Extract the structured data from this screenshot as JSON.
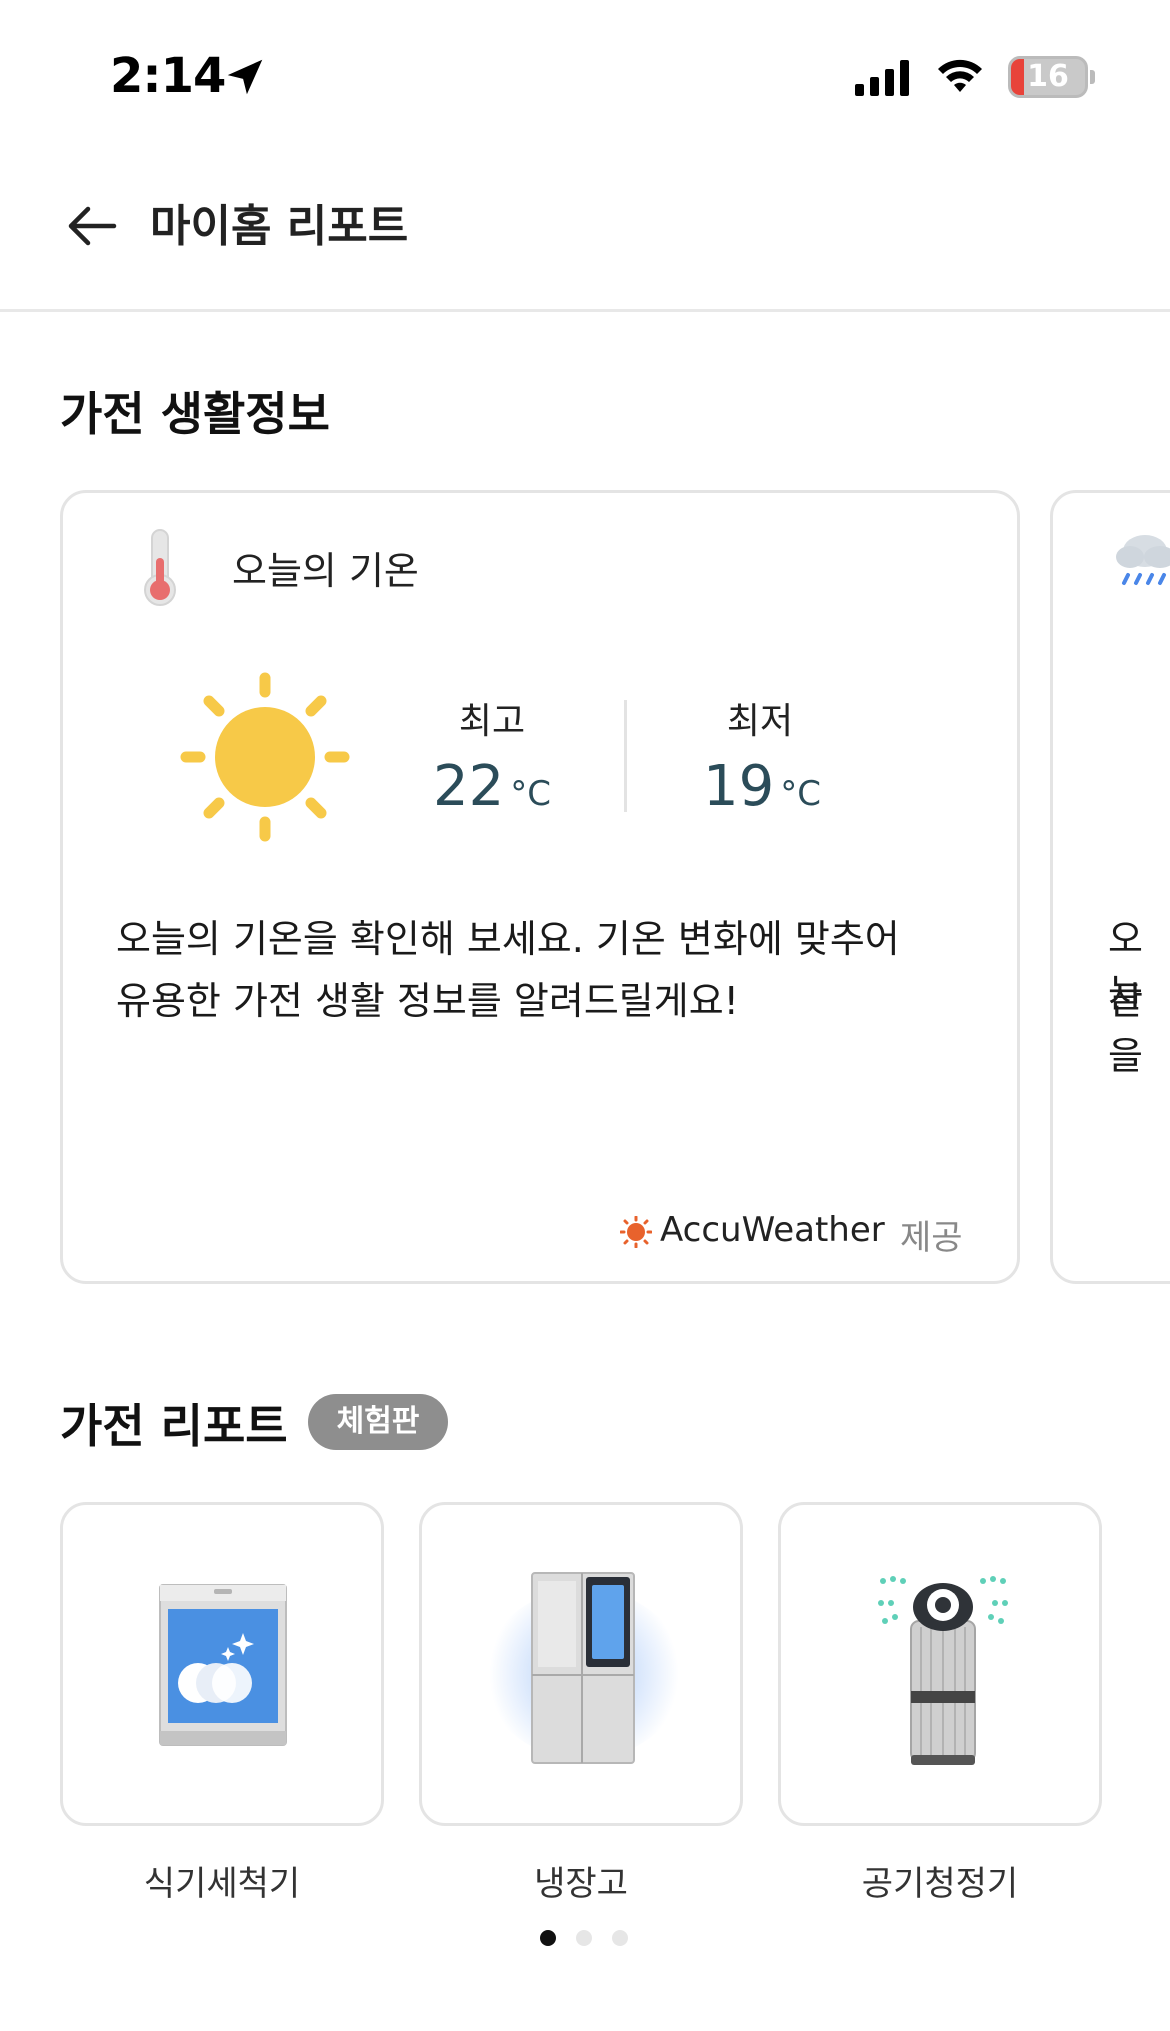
{
  "status_bar": {
    "time": "2:14",
    "battery": "16"
  },
  "header": {
    "title": "마이홈 리포트"
  },
  "appliance_life": {
    "section_title": "가전 생활정보",
    "weather_card": {
      "title": "오늘의 기온",
      "high_label": "최고",
      "high_value": "22",
      "low_label": "최저",
      "low_value": "19",
      "unit": "°C",
      "description_line1": "오늘의 기온을 확인해 보세요. 기온 변화에 맞추어",
      "description_line2": "유용한 가전 생활 정보를 알려드릴게요!",
      "provider": "AccuWeather",
      "provider_suffix": "제공"
    },
    "peek_card": {
      "line1": "오늘",
      "line2": "산을"
    }
  },
  "appliance_report": {
    "section_title": "가전 리포트",
    "badge": "체험판",
    "items": [
      {
        "label": "식기세척기",
        "icon": "dishwasher-icon"
      },
      {
        "label": "냉장고",
        "icon": "refrigerator-icon"
      },
      {
        "label": "공기청정기",
        "icon": "air-purifier-icon"
      }
    ],
    "pagination": {
      "current": 1,
      "total": 3
    }
  },
  "colors": {
    "temperature": "#2b4c59",
    "sun": "#f7c948",
    "badge": "#8e8e8e",
    "card_border": "#e4e4e4"
  }
}
